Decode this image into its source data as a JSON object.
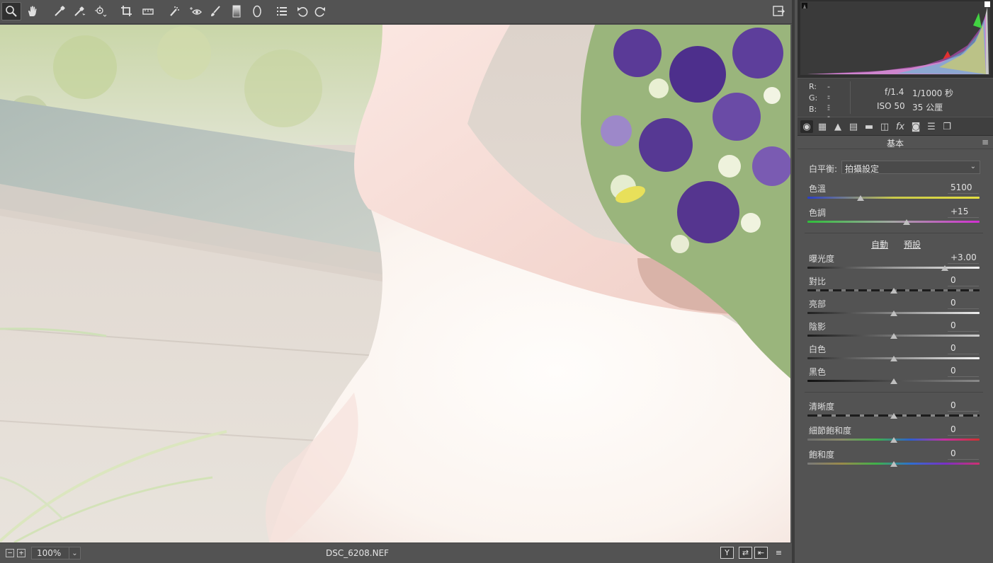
{
  "toolbar": {
    "tools": [
      {
        "name": "zoom-tool-icon",
        "glyph": "zoom"
      },
      {
        "name": "hand-tool-icon",
        "glyph": "hand"
      },
      {
        "name": "white-balance-tool-icon",
        "glyph": "eyedropper"
      },
      {
        "name": "color-sampler-tool-icon",
        "glyph": "sampler"
      },
      {
        "name": "targeted-adjustment-tool-icon",
        "glyph": "target"
      },
      {
        "name": "crop-tool-icon",
        "glyph": "crop"
      },
      {
        "name": "straighten-tool-icon",
        "glyph": "level"
      },
      {
        "name": "spot-removal-tool-icon",
        "glyph": "spot"
      },
      {
        "name": "red-eye-tool-icon",
        "glyph": "eye"
      },
      {
        "name": "adjustment-brush-icon",
        "glyph": "brush"
      },
      {
        "name": "graduated-filter-icon",
        "glyph": "grad"
      },
      {
        "name": "radial-filter-icon",
        "glyph": "radial"
      },
      {
        "name": "preferences-list-icon",
        "glyph": "list"
      },
      {
        "name": "rotate-ccw-icon",
        "glyph": "rotl"
      },
      {
        "name": "rotate-cw-icon",
        "glyph": "rotr"
      }
    ]
  },
  "status": {
    "zoom": "100%",
    "filename": "DSC_6208.NEF",
    "zoom_out_glyph": "−",
    "zoom_in_glyph": "+",
    "view_glyphs": [
      "Y",
      "⇄",
      "⇤",
      "≡"
    ]
  },
  "histogram_info": {
    "r_label": "R:",
    "r_value": "---",
    "g_label": "G:",
    "g_value": "---",
    "b_label": "B:",
    "b_value": "---",
    "aperture": "f/1.4",
    "shutter": "1/1000 秒",
    "iso": "ISO 50",
    "focal": "35 公厘"
  },
  "panel": {
    "title": "基本",
    "menu_glyph": "≡",
    "white_balance_label": "白平衡:",
    "white_balance_value": "拍攝設定",
    "auto_link": "自動",
    "default_link": "預設",
    "sliders": [
      {
        "label": "色溫",
        "value": "5100",
        "level": 0.31
      },
      {
        "label": "色調",
        "value": "+15",
        "level": 0.575
      },
      {
        "label": "曝光度",
        "value": "+3.00",
        "level": 0.8
      },
      {
        "label": "對比",
        "value": "0",
        "level": 0.5
      },
      {
        "label": "亮部",
        "value": "0",
        "level": 0.5
      },
      {
        "label": "陰影",
        "value": "0",
        "level": 0.5
      },
      {
        "label": "白色",
        "value": "0",
        "level": 0.5
      },
      {
        "label": "黑色",
        "value": "0",
        "level": 0.5
      },
      {
        "label": "清晰度",
        "value": "0",
        "level": 0.5
      },
      {
        "label": "細節飽和度",
        "value": "0",
        "level": 0.5
      },
      {
        "label": "飽和度",
        "value": "0",
        "level": 0.5
      }
    ]
  },
  "colors": {
    "accent_panel": "#535353",
    "histogram_bg": "#2f2f2f"
  }
}
